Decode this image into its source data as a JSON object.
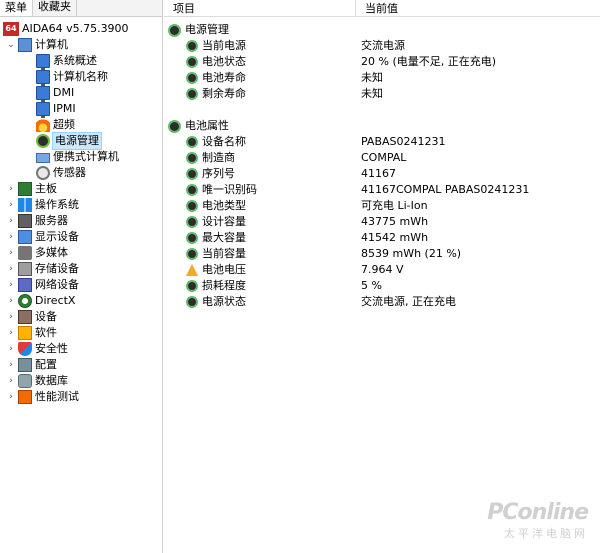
{
  "tabs": [
    "菜单",
    "收藏夹"
  ],
  "tree": {
    "root": "AIDA64 v5.75.3900",
    "computer": "计算机",
    "computer_children": [
      "系统概述",
      "计算机名称",
      "DMI",
      "IPMI",
      "超频",
      "电源管理",
      "便携式计算机",
      "传感器"
    ],
    "categories": [
      "主板",
      "操作系统",
      "服务器",
      "显示设备",
      "多媒体",
      "存储设备",
      "网络设备",
      "DirectX",
      "设备",
      "软件",
      "安全性",
      "配置",
      "数据库",
      "性能测试"
    ]
  },
  "columns": {
    "item": "项目",
    "value": "当前值"
  },
  "groups": {
    "power": {
      "title": "电源管理",
      "rows": [
        {
          "key": "当前电源",
          "value": "交流电源"
        },
        {
          "key": "电池状态",
          "value": "20 % (电量不足, 正在充电)"
        },
        {
          "key": "电池寿命",
          "value": "未知"
        },
        {
          "key": "剩余寿命",
          "value": "未知"
        }
      ]
    },
    "battery": {
      "title": "电池属性",
      "rows": [
        {
          "key": "设备名称",
          "value": "PABAS0241231"
        },
        {
          "key": "制造商",
          "value": "COMPAL"
        },
        {
          "key": "序列号",
          "value": "41167"
        },
        {
          "key": "唯一识别码",
          "value": "41167COMPAL PABAS0241231"
        },
        {
          "key": "电池类型",
          "value": "可充电 Li-Ion"
        },
        {
          "key": "设计容量",
          "value": "43775 mWh"
        },
        {
          "key": "最大容量",
          "value": "41542 mWh"
        },
        {
          "key": "当前容量",
          "value": "8539 mWh  (21 %)"
        },
        {
          "key": "电池电压",
          "value": "7.964 V"
        },
        {
          "key": "损耗程度",
          "value": "5 %"
        },
        {
          "key": "电源状态",
          "value": "交流电源, 正在充电"
        }
      ]
    }
  },
  "watermark": {
    "brand": "PConline",
    "sub": "太平洋电脑网"
  },
  "colors": {
    "selection": "#cce8ff",
    "warning": "#f9a825"
  }
}
